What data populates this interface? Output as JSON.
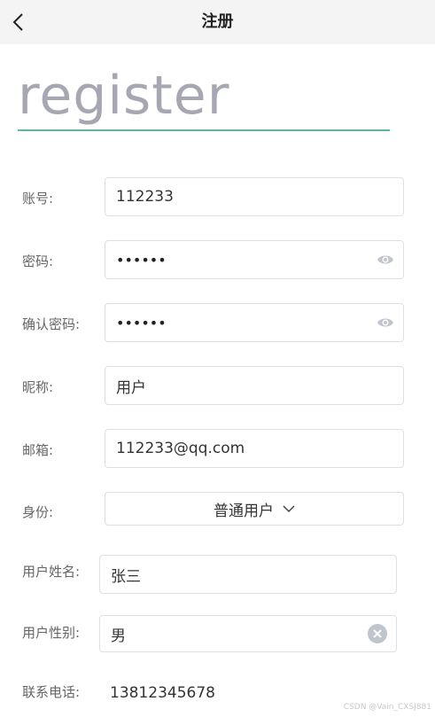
{
  "nav": {
    "title": "注册"
  },
  "hero": {
    "text": "register"
  },
  "form": {
    "account": {
      "label": "账号:",
      "value": "112233"
    },
    "password": {
      "label": "密码:",
      "value": "••••••"
    },
    "confirm": {
      "label": "确认密码:",
      "value": "••••••"
    },
    "nickname": {
      "label": "昵称:",
      "value": "用户"
    },
    "email": {
      "label": "邮箱:",
      "value": "112233@qq.com"
    },
    "identity": {
      "label": "身份:",
      "value": "普通用户"
    },
    "realname": {
      "label": "用户姓名:",
      "value": "张三"
    },
    "gender": {
      "label": "用户性别:",
      "value": "男"
    },
    "phone": {
      "label": "联系电话:",
      "value": "13812345678"
    }
  },
  "watermark": "CSDN @Vain_CXSJ881",
  "colors": {
    "accent": "#5fb89a",
    "hero": "#a7a7b3",
    "border": "#dcdfe6"
  }
}
